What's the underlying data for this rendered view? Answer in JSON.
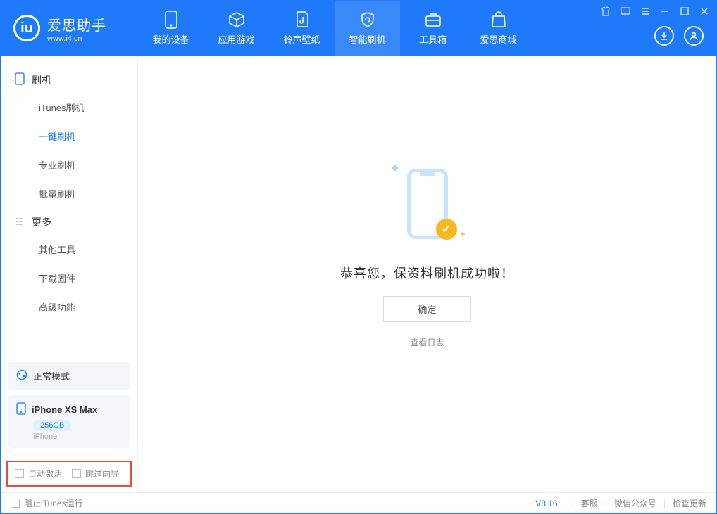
{
  "logo": {
    "letter": "iu",
    "title": "爱思助手",
    "subtitle": "www.i4.cn"
  },
  "tabs": [
    {
      "label": "我的设备"
    },
    {
      "label": "应用游戏"
    },
    {
      "label": "铃声壁纸"
    },
    {
      "label": "智能刷机"
    },
    {
      "label": "工具箱"
    },
    {
      "label": "爱思商城"
    }
  ],
  "sidebar": {
    "group1": {
      "title": "刷机",
      "items": [
        "iTunes刷机",
        "一键刷机",
        "专业刷机",
        "批量刷机"
      ]
    },
    "group2": {
      "title": "更多",
      "items": [
        "其他工具",
        "下载固件",
        "高级功能"
      ]
    }
  },
  "mode": {
    "label": "正常模式"
  },
  "device": {
    "name": "iPhone XS Max",
    "capacity": "256GB",
    "type": "iPhone"
  },
  "checkboxes": {
    "auto_activate": "自动激活",
    "skip_guide": "跳过向导"
  },
  "main": {
    "success_text": "恭喜您，保资料刷机成功啦！",
    "ok_button": "确定",
    "log_link": "查看日志"
  },
  "footer": {
    "block_itunes": "阻止iTunes运行",
    "version": "V8.16",
    "links": [
      "客服",
      "微信公众号",
      "检查更新"
    ]
  }
}
